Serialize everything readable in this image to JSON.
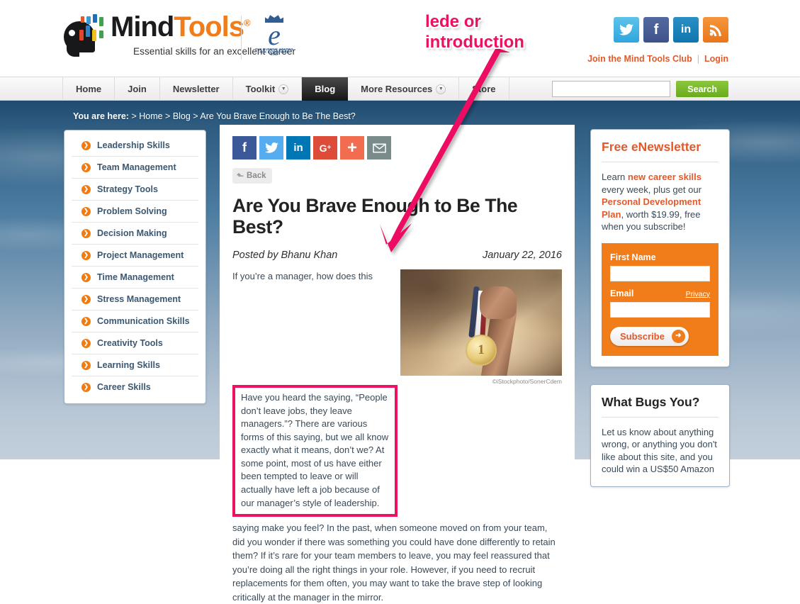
{
  "brand": {
    "name_part1": "Mind",
    "name_part2": "Tools",
    "registered": "®",
    "tagline": "Essential skills for an excellent career",
    "award_line1": "THE QUEEN'S AWARDS",
    "award_line2": "FOR ENTERPRISE",
    "award_line3": "2012"
  },
  "header": {
    "social": [
      {
        "name": "twitter",
        "glyph": "✉",
        "color": "#30a5dd"
      },
      {
        "name": "facebook",
        "glyph": "f",
        "color": "#3c5389"
      },
      {
        "name": "linkedin",
        "glyph": "in",
        "color": "#0e76ae"
      },
      {
        "name": "rss",
        "glyph": "◜",
        "color": "#e9761a"
      }
    ],
    "join_link": "Join the Mind Tools Club",
    "separator": "|",
    "login_link": "Login"
  },
  "nav": {
    "items": [
      {
        "label": "Home",
        "has_caret": false,
        "active": false
      },
      {
        "label": "Join",
        "has_caret": false,
        "active": false
      },
      {
        "label": "Newsletter",
        "has_caret": false,
        "active": false
      },
      {
        "label": "Toolkit",
        "has_caret": true,
        "active": false
      },
      {
        "label": "Blog",
        "has_caret": false,
        "active": true
      },
      {
        "label": "More Resources",
        "has_caret": true,
        "active": false
      },
      {
        "label": "Store",
        "has_caret": false,
        "active": false
      }
    ],
    "search_placeholder": "",
    "search_value": "",
    "search_button": "Search"
  },
  "breadcrumb": {
    "prefix": "You are here:",
    "trail": "> Home > Blog > Are You Brave Enough to Be The Best?"
  },
  "sidebar": {
    "items": [
      {
        "label": "Leadership Skills"
      },
      {
        "label": "Team Management"
      },
      {
        "label": "Strategy Tools"
      },
      {
        "label": "Problem Solving"
      },
      {
        "label": "Decision Making"
      },
      {
        "label": "Project Management"
      },
      {
        "label": "Time Management"
      },
      {
        "label": "Stress Management"
      },
      {
        "label": "Communication Skills"
      },
      {
        "label": "Creativity Tools"
      },
      {
        "label": "Learning Skills"
      },
      {
        "label": "Career Skills"
      }
    ]
  },
  "article": {
    "share_buttons": [
      {
        "name": "facebook",
        "glyph": "f",
        "color": "#3b5998"
      },
      {
        "name": "twitter",
        "glyph": "✉",
        "color": "#55acee"
      },
      {
        "name": "linkedin",
        "glyph": "in",
        "color": "#0077b5"
      },
      {
        "name": "google-plus",
        "glyph": "G+",
        "color": "#dd4b39"
      },
      {
        "name": "addthis",
        "glyph": "+",
        "color": "#f26c4f"
      },
      {
        "name": "email",
        "glyph": "✉",
        "color": "#7a8b8b"
      }
    ],
    "back_label": "Back",
    "title": "Are You Brave Enough to Be The Best?",
    "author": "Posted by Bhanu Khan",
    "date": "January 22, 2016",
    "lede": "Have you heard the saying, “People don’t leave jobs, they leave managers.”? There are various forms of this saying, but we all know exactly what it means, don’t we? At some point, most of us have either been tempted to leave or will actually have left a job because of our manager’s style of leadership.",
    "body_first": "If you’re a manager, how does this",
    "body_rest": "saying make you feel? In the past, when someone moved on from your team, did you wonder if there was something you could have done differently to retain them? If it’s rare for your team members to leave, you may feel reassured that you’re doing all the right things in your role. However, if you need to recruit replacements for them often, you may want to take the brave step of looking critically at the manager in the mirror.",
    "image_credit": "©iStockphoto/SonerCdem",
    "image_alt_medal_number": "1"
  },
  "newsletter": {
    "title": "Free eNewsletter",
    "text_1": "Learn ",
    "highlight_1": "new career skills",
    "text_2": " every week, plus get our ",
    "highlight_2": "Personal Development Plan",
    "text_3": ", worth $19.99, free when you subscribe!",
    "first_name_label": "First Name",
    "first_name_value": "",
    "email_label": "Email",
    "email_value": "",
    "privacy_label": "Privacy",
    "subscribe_label": "Subscribe"
  },
  "bugs": {
    "title": "What Bugs You?",
    "text": "Let us know about anything wrong, or anything you don't like about this site, and you could win a US$50 Amazon"
  },
  "annotation": {
    "label": "lede or\nintroduction",
    "color": "#ec1163"
  }
}
